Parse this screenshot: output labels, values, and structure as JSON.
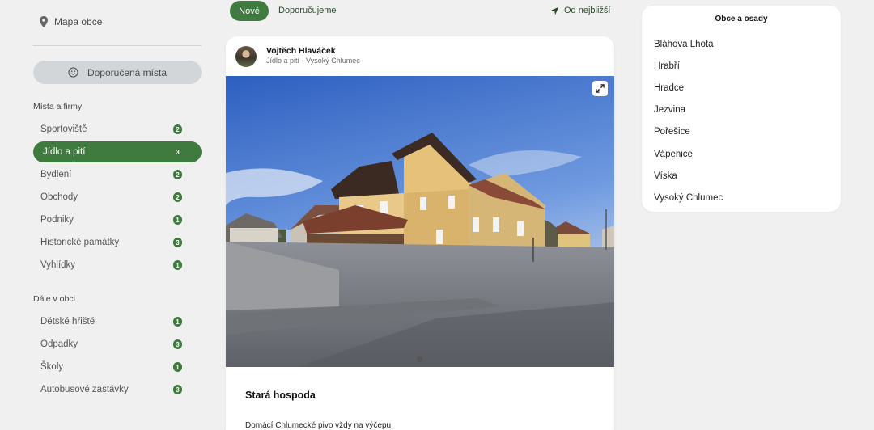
{
  "sidebar": {
    "map_label": "Mapa obce",
    "recommended_label": "Doporučená místa",
    "places_section": "Místa a firmy",
    "places": [
      {
        "label": "Sportoviště",
        "count": "2"
      },
      {
        "label": "Jídlo a pití",
        "count": "3",
        "active": true
      },
      {
        "label": "Bydlení",
        "count": "2"
      },
      {
        "label": "Obchody",
        "count": "2"
      },
      {
        "label": "Podniky",
        "count": "1"
      },
      {
        "label": "Historické památky",
        "count": "3"
      },
      {
        "label": "Vyhlídky",
        "count": "1"
      }
    ],
    "more_section": "Dále v obci",
    "more": [
      {
        "label": "Dětské hřiště",
        "count": "1"
      },
      {
        "label": "Odpadky",
        "count": "3"
      },
      {
        "label": "Školy",
        "count": "1"
      },
      {
        "label": "Autobusové zastávky",
        "count": "3"
      }
    ]
  },
  "feed": {
    "tab_new": "Nové",
    "tab_recommended": "Doporučujeme",
    "sort_label": "Od nejbližší"
  },
  "post": {
    "author": "Vojtěch Hlaváček",
    "subtitle": "Jídlo a pití - Vysoký Chlumec",
    "title": "Stará hospoda",
    "description": "Domácí Chlumecké pivo vždy na výčepu."
  },
  "villages": {
    "title": "Obce a osady",
    "items": [
      "Bláhova Lhota",
      "Hrabří",
      "Hradce",
      "Jezvina",
      "Pořešice",
      "Vápenice",
      "Víska",
      "Vysoký Chlumec"
    ]
  },
  "colors": {
    "accent": "#3f7a3f",
    "background": "#f0f0f0",
    "button_gray": "#d3d6d9"
  }
}
